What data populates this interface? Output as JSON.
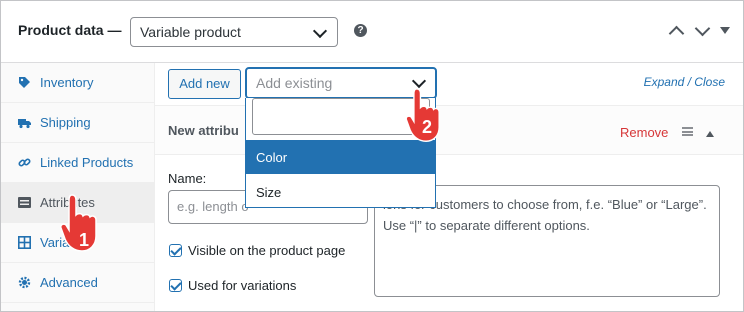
{
  "header": {
    "title": "Product data —",
    "product_type": "Variable product",
    "help": "?"
  },
  "sidebar": {
    "items": [
      {
        "label": "Inventory",
        "icon": "tag-icon"
      },
      {
        "label": "Shipping",
        "icon": "truck-icon"
      },
      {
        "label": "Linked Products",
        "icon": "link-icon"
      },
      {
        "label": "Attributes",
        "icon": "list-icon"
      },
      {
        "label": "Varia",
        "icon": "grid-icon"
      },
      {
        "label": "Advanced",
        "icon": "gear-icon"
      }
    ]
  },
  "toolbar": {
    "add_new": "Add new",
    "add_existing_placeholder": "Add existing",
    "expand_close": "Expand / Close"
  },
  "dropdown": {
    "options": [
      "Color",
      "Size"
    ]
  },
  "attribute": {
    "header": "New attribu",
    "remove": "Remove",
    "name_label": "Name:",
    "name_placeholder": "e.g. length o",
    "values_text": "ions for customers to choose from, f.e. “Blue” or “Large”. Use “|” to separate different options.",
    "visible_label": "Visible on the product page",
    "variations_label": "Used for variations"
  },
  "callouts": [
    "1",
    "2"
  ],
  "colors": {
    "accent": "#2271b1",
    "remove": "#d63638",
    "callout": "#e53935"
  }
}
